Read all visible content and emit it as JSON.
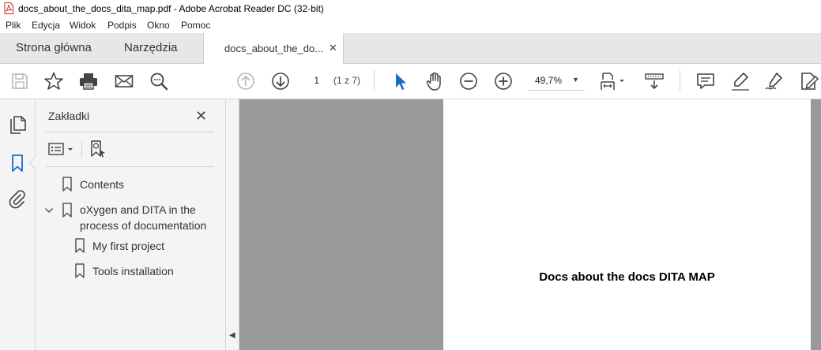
{
  "window": {
    "title": "docs_about_the_docs_dita_map.pdf - Adobe Acrobat Reader DC (32-bit)"
  },
  "menu": [
    "Plik",
    "Edycja",
    "Widok",
    "Podpis",
    "Okno",
    "Pomoc"
  ],
  "tabs": {
    "home": "Strona główna",
    "tools": "Narzędzia",
    "document": "docs_about_the_do...",
    "close": "✕"
  },
  "toolbar": {
    "page_number": "1",
    "page_count": "(1 z 7)",
    "zoom": "49,7%",
    "icons": [
      "save-icon",
      "star-icon",
      "print-icon",
      "mail-icon",
      "search-icon",
      "prev-page-icon",
      "next-page-icon",
      "select-cursor-icon",
      "hand-icon",
      "zoom-out-icon",
      "zoom-in-icon",
      "fit-page-icon",
      "scroll-mode-icon",
      "comment-icon",
      "highlight-icon",
      "sign-icon",
      "edit-pdf-icon"
    ]
  },
  "panel": {
    "title": "Zakładki",
    "close": "✕",
    "bookmarks": [
      {
        "label": "Contents",
        "level": 0
      },
      {
        "label": "oXygen and DITA in the",
        "label2": "process of documentation",
        "level": 0,
        "expanded": true
      },
      {
        "label": "My first project",
        "level": 1
      },
      {
        "label": "Tools installation",
        "level": 1
      }
    ]
  },
  "document": {
    "heading": "Docs about the docs DITA MAP"
  },
  "colors": {
    "accent": "#1b6ac9",
    "pdf_red": "#d2232a",
    "doc_background": "#999999"
  }
}
